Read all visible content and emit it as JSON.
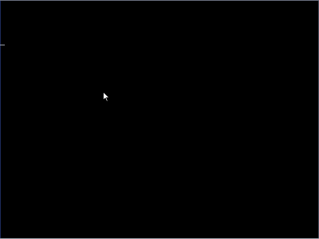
{
  "screen": {
    "background_color": "#000000",
    "border_top_color": "#6a7080",
    "border_bottom_color": "#9aa0a8",
    "border_left_color": "#1c2a5a",
    "border_right_color": "#4a5060"
  },
  "cursor": {
    "icon": "arrow-pointer-icon",
    "color": "#ffffff"
  }
}
